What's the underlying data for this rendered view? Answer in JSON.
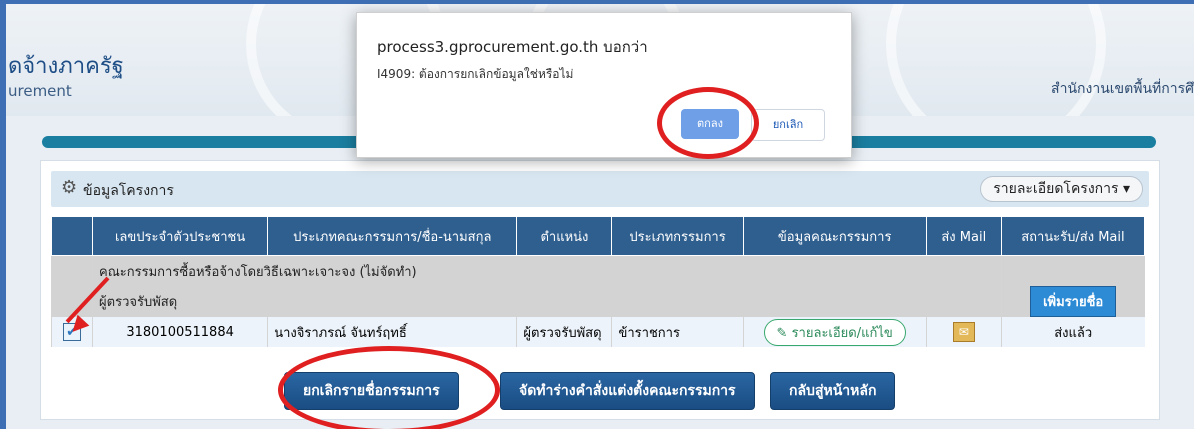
{
  "header": {
    "title_th": "ดจ้างภาครัฐ",
    "title_en": "urement",
    "office": "สำนักงานเขตพื้นที่การศึ"
  },
  "panel": {
    "title": "ข้อมูลโครงการ",
    "detail_button": "รายละเอียดโครงการ ▾"
  },
  "table": {
    "headers": [
      "",
      "เลขประจำตัวประชาชน",
      "ประเภทคณะกรรมการ/ชื่อ-นามสกุล",
      "ตำแหน่ง",
      "ประเภทกรรมการ",
      "ข้อมูลคณะกรรมการ",
      "ส่ง Mail",
      "สถานะรับ/ส่ง Mail"
    ],
    "group1": "คณะกรรมการซื้อหรือจ้างโดยวิธีเฉพาะเจาะจง (ไม่จัดทำ)",
    "group2": "ผู้ตรวจรับพัสดุ",
    "add_button": "เพิ่มรายชื่อ",
    "row": {
      "checked": "✔",
      "id": "3180100511884",
      "name": "นางจิราภรณ์ จันทร์ฤทธิ์",
      "position": "ผู้ตรวจรับพัสดุ",
      "type": "ข้าราชการ",
      "edit_label": "รายละเอียด/แก้ไข",
      "mail_icon": "✉",
      "status": "ส่งแล้ว"
    }
  },
  "actions": {
    "cancel_names": "ยกเลิกรายชื่อกรรมการ",
    "draft_order": "จัดทำร่างคำสั่งแต่งตั้งคณะกรรมการ",
    "back_home": "กลับสู่หน้าหลัก"
  },
  "dialog": {
    "title": "process3.gprocurement.go.th บอกว่า",
    "message": "I4909: ต้องการยกเลิกข้อมูลใช่หรือไม่",
    "ok": "ตกลง",
    "cancel": "ยกเลิก"
  },
  "colors": {
    "accent": "#2f5f8f",
    "annotation": "#e02020"
  }
}
